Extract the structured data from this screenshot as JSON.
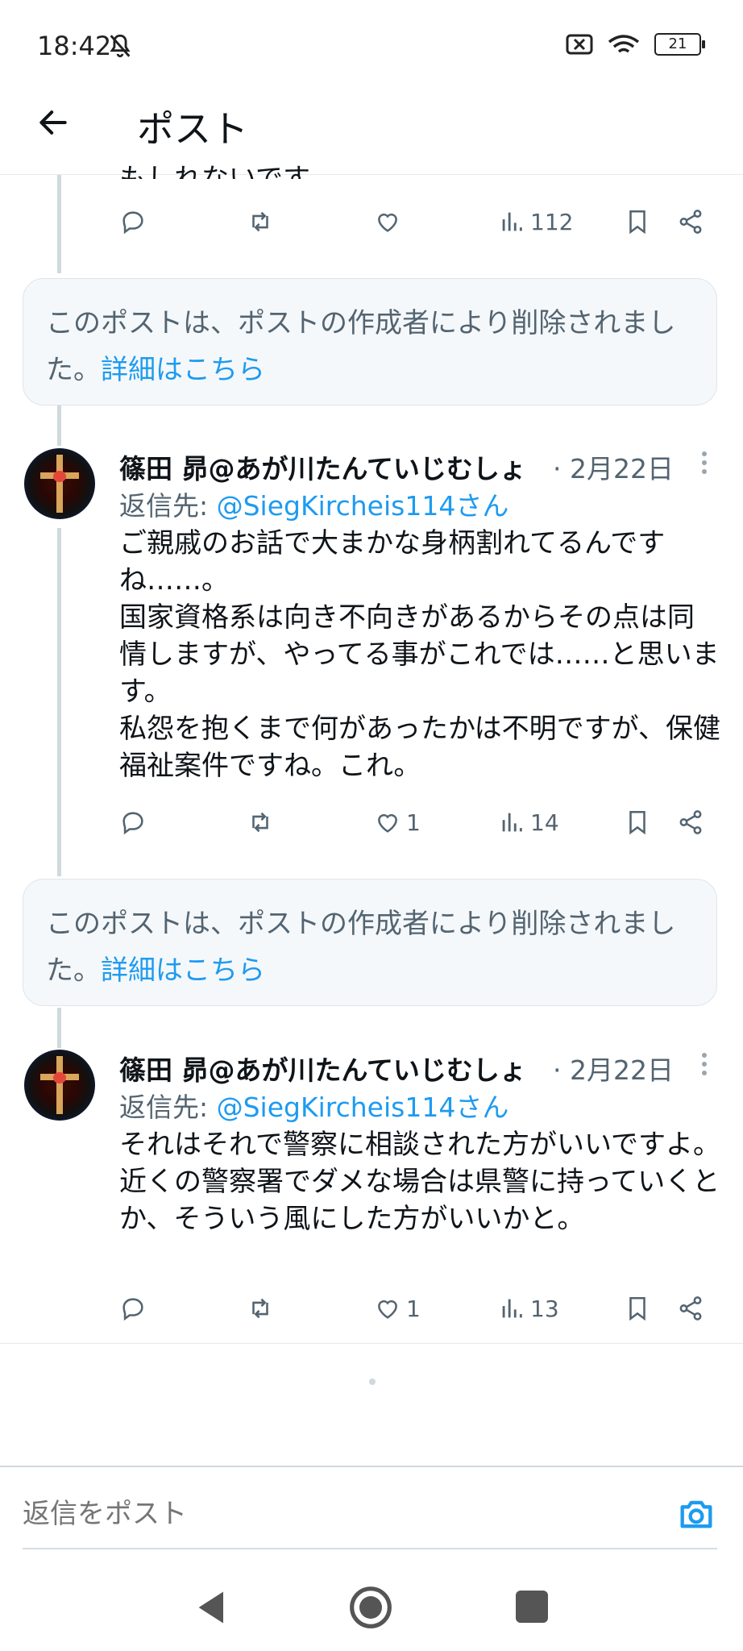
{
  "status_bar": {
    "time": "18:42",
    "battery": "21"
  },
  "header": {
    "title": "ポスト"
  },
  "top_post": {
    "cut_text": "もしれないです。",
    "views": "112"
  },
  "deleted_notice": {
    "text": "このポストは、ポストの作成者により削除されました。",
    "link": "詳細はこちら"
  },
  "posts": [
    {
      "author": "篠田 昴@あが川たんていじむしょ",
      "date": "· 2月22日",
      "reply_prefix": "返信先: ",
      "reply_handle": "@SiegKircheis114さん",
      "text": "ご親戚のお話で大まかな身柄割れてるんですね……。\n国家資格系は向き不向きがあるからその点は同情しますが、やってる事がこれでは……と思います。\n私怨を抱くまで何があったかは不明ですが、保健福祉案件ですね。これ。",
      "likes": "1",
      "views": "14"
    },
    {
      "author": "篠田 昴@あが川たんていじむしょ",
      "date": "· 2月22日",
      "reply_prefix": "返信先: ",
      "reply_handle": "@SiegKircheis114さん",
      "text": "それはそれで警察に相談された方がいいですよ。\n近くの警察署でダメな場合は県警に持っていくとか、そういう風にした方がいいかと。",
      "likes": "1",
      "views": "13"
    }
  ],
  "reply_box": {
    "placeholder": "返信をポスト"
  },
  "colors": {
    "accent": "#1d9bf0",
    "muted": "#536471",
    "text": "#0f1419"
  }
}
